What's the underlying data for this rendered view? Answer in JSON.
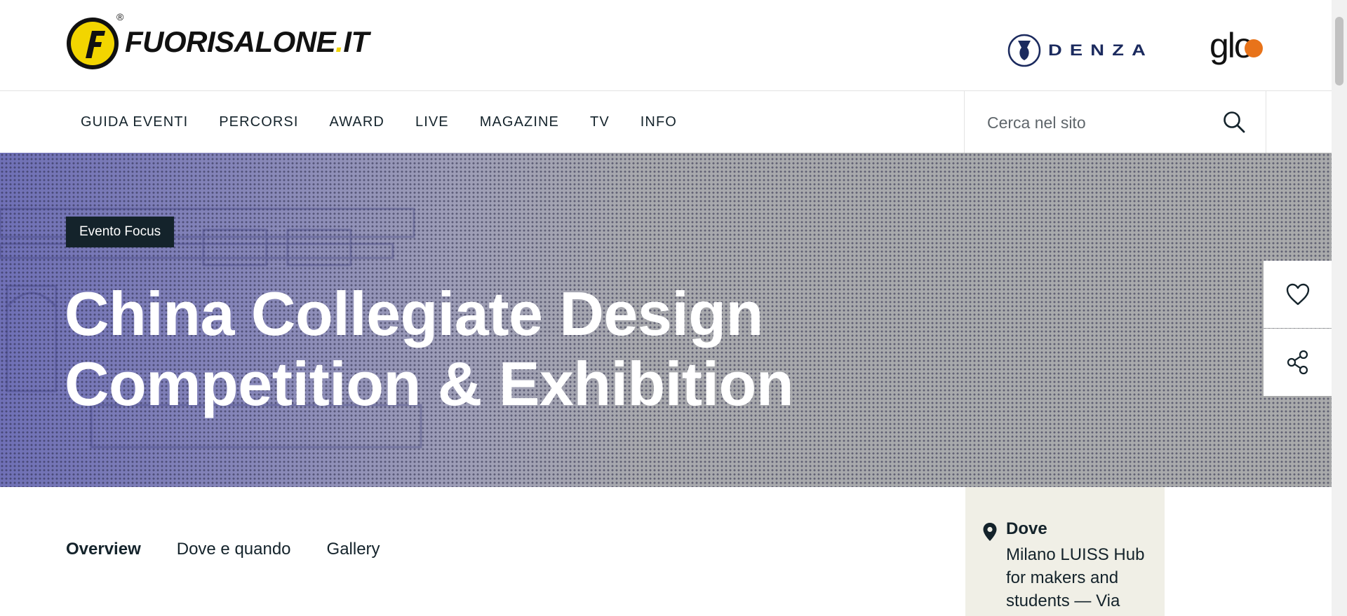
{
  "header": {
    "logo_text_main": "FUORISALONE",
    "logo_text_dot": ".",
    "logo_text_tld": "IT",
    "logo_registered": "®",
    "sponsors": [
      {
        "name": "DENZA",
        "icon": "denza-logo"
      },
      {
        "name": "glo",
        "icon": "glo-logo"
      }
    ]
  },
  "nav": {
    "items": [
      "GUIDA EVENTI",
      "PERCORSI",
      "AWARD",
      "LIVE",
      "MAGAZINE",
      "TV",
      "INFO"
    ],
    "search_placeholder": "Cerca nel sito",
    "search_icon": "search-icon"
  },
  "hero": {
    "badge": "Evento Focus",
    "title_line1": "China Collegiate Design",
    "title_line2": "Competition & Exhibition"
  },
  "actions": {
    "favorite_icon": "heart-icon",
    "share_icon": "share-icon"
  },
  "tabs": [
    "Overview",
    "Dove e quando",
    "Gallery"
  ],
  "dove": {
    "title": "Dove",
    "text": "Milano LUISS Hub for makers and students — Via",
    "icon": "map-pin-icon"
  },
  "colors": {
    "dark": "#14232b",
    "brand_yellow": "#f2d500",
    "card_bg": "#f0efe6",
    "glo_orange": "#e8731a",
    "denza_navy": "#1b2a5e"
  }
}
